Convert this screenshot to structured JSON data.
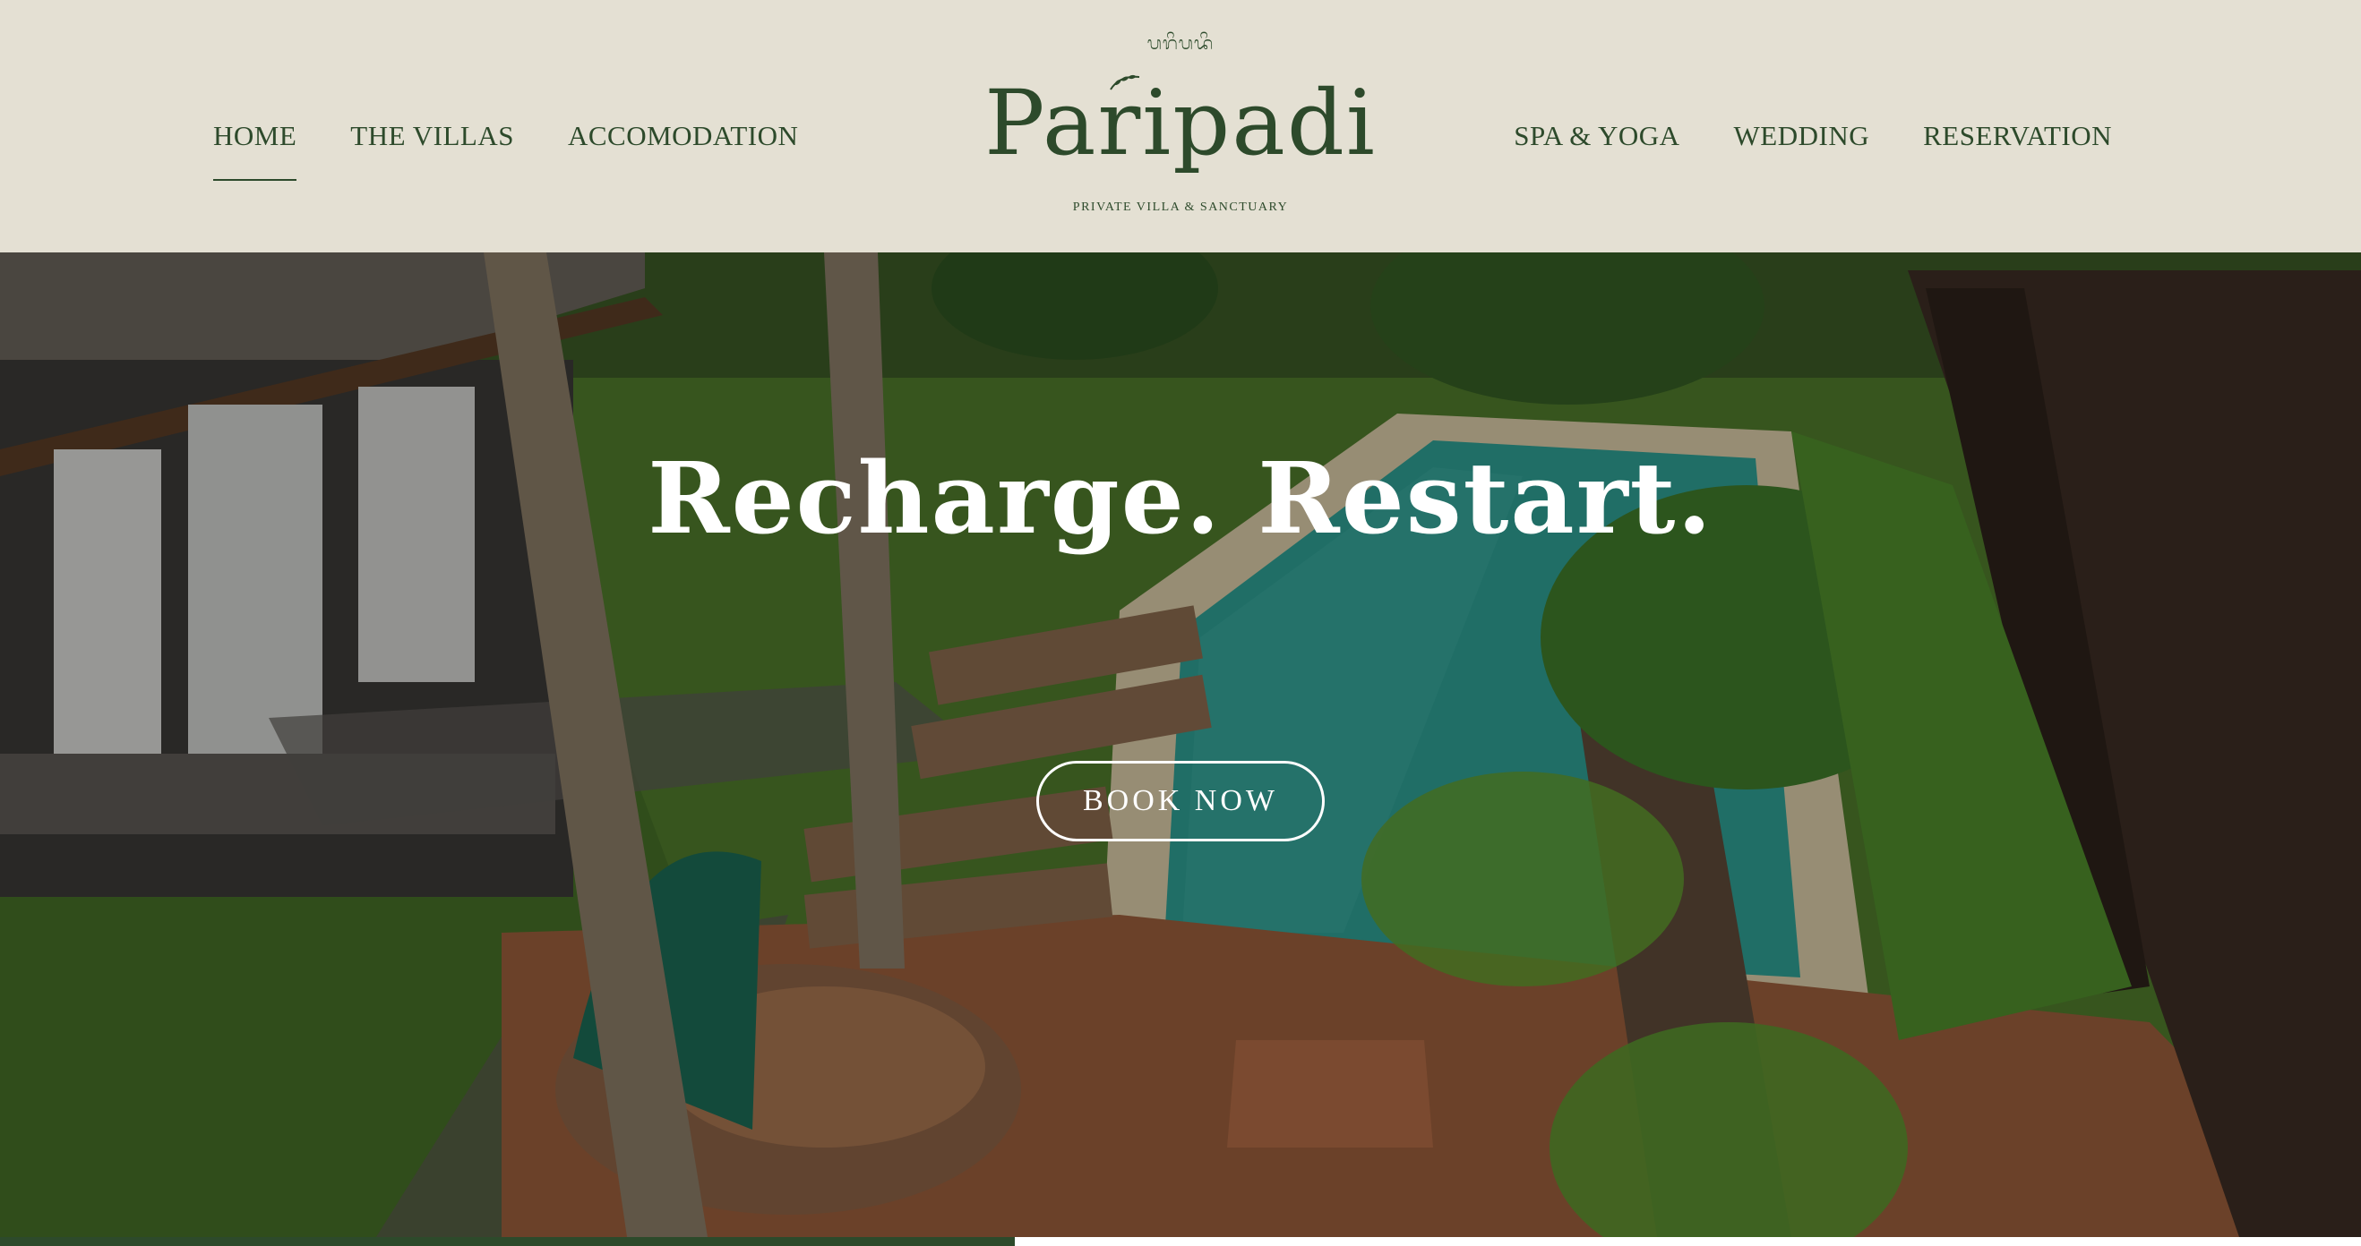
{
  "brand": {
    "script_text": "ᬧᬭᬶᬧᬤᬶ",
    "logo_text": "Paripadi",
    "tagline": "PRIVATE VILLA & SANCTUARY"
  },
  "nav": {
    "left": [
      {
        "label": "HOME",
        "active": true
      },
      {
        "label": "THE VILLAS",
        "active": false
      },
      {
        "label": "ACCOMODATION",
        "active": false
      }
    ],
    "right": [
      {
        "label": "SPA & YOGA",
        "active": false
      },
      {
        "label": "WEDDING",
        "active": false
      },
      {
        "label": "RESERVATION",
        "active": false
      }
    ]
  },
  "hero": {
    "title": "Recharge. Restart.",
    "cta_label": "BOOK NOW",
    "image_description_icon": "resort-pool-photo"
  },
  "slider": {
    "progress_fraction": 0.43
  },
  "colors": {
    "header_bg": "#e4e0d3",
    "brand_green": "#2d4a2b",
    "hero_text": "#ffffff"
  }
}
